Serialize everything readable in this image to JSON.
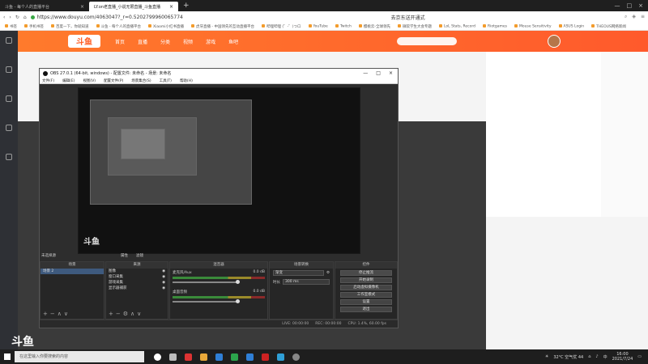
{
  "browser": {
    "tabs": [
      {
        "title": "斗鱼 - 每个人的直播平台",
        "active": false
      },
      {
        "title": "LY.on老直播_小说无限直播_斗鱼直播",
        "active": true
      }
    ],
    "url": "https://www.douyu.com/4063047?_r=0.5202799960065774",
    "search_hint": "去京东送开通式",
    "bookmarks": [
      "书签",
      "手机书签",
      "百度一下，你就知道",
      "斗鱼 - 每个人的直播平台",
      "Xiaomi小红书直播",
      "虎牙直播 - 中国领先的互动直播平台",
      "哔哩哔哩 (゜-゜)つロ",
      "YouTube",
      "Twitch",
      "樱桃云-全球领先",
      "微软学生大会专题",
      "LoL Stats, Record",
      "Riotgames",
      "Mouse Sensitivity",
      "ASUS Login",
      "THEOUS网络新闻"
    ]
  },
  "douyu": {
    "logo": "斗鱼",
    "nav": [
      "首页",
      "直播",
      "分类",
      "视频",
      "游戏",
      "鱼吧"
    ],
    "bottom_logo": "斗鱼"
  },
  "obs": {
    "title": "OBS 27.0.1 (64-bit, windows) - 配置文件: 未命名 - 场景: 未命名",
    "menu": [
      "文件(F)",
      "编辑(E)",
      "视图(V)",
      "配置文件(P)",
      "场景集合(S)",
      "工具(T)",
      "帮助(H)"
    ],
    "scene_bar": {
      "label": "未选择源",
      "properties": "属性",
      "filters": "滤镜"
    },
    "docks": {
      "scenes": {
        "header": "场景",
        "items": [
          "场景 2"
        ]
      },
      "sources": {
        "header": "来源",
        "items": [
          "图像",
          "窗口采集",
          "游戏采集",
          "显示器捕获"
        ]
      },
      "mixer": {
        "header": "混音器",
        "channels": [
          {
            "name": "麦克风/Aux",
            "db": "0.0 dB"
          },
          {
            "name": "桌面音频",
            "db": "0.0 dB"
          }
        ]
      },
      "transitions": {
        "header": "场景转换",
        "type": "渐变",
        "duration_label": "时长",
        "duration": "300 ms"
      },
      "controls": {
        "header": "控件",
        "buttons": [
          "停止推流",
          "开始录制",
          "启动虚拟摄像机",
          "工作室模式",
          "设置",
          "退出"
        ]
      }
    },
    "status": {
      "live": "LIVE: 00:00:00",
      "rec": "REC: 00:00:00",
      "cpu": "CPU: 1.4%, 60.00 fps"
    },
    "preview_logo": "斗鱼"
  },
  "taskbar": {
    "search_placeholder": "在这里输入你要搜索的内容",
    "weather": "32°C 空气优 44",
    "time": "16:00",
    "date": "2021/7/24",
    "lang": "中"
  }
}
